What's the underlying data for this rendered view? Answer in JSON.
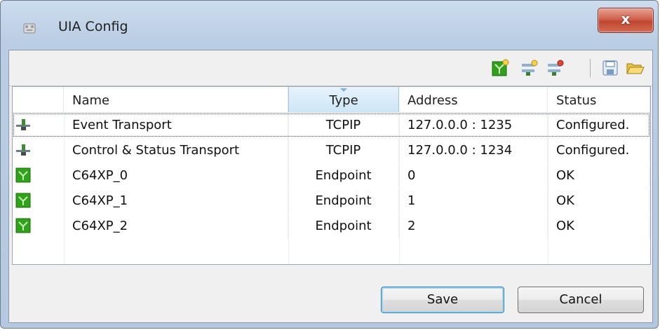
{
  "window": {
    "title": "UIA Config",
    "close_label": "x"
  },
  "toolbar": {
    "buttons": [
      {
        "icon": "add-endpoint-icon"
      },
      {
        "icon": "add-transport-icon"
      },
      {
        "icon": "remove-transport-icon"
      },
      {
        "icon": "save-icon"
      },
      {
        "icon": "open-folder-icon"
      }
    ]
  },
  "table": {
    "columns": [
      "Name",
      "Type",
      "Address",
      "Status"
    ],
    "rows": [
      {
        "icon": "transport-icon",
        "name": "Event Transport",
        "type": "TCPIP",
        "address": "127.0.0.0 : 1235",
        "status": "Configured."
      },
      {
        "icon": "transport-icon",
        "name": "Control & Status Transport",
        "type": "TCPIP",
        "address": "127.0.0.0 : 1234",
        "status": "Configured."
      },
      {
        "icon": "endpoint-icon",
        "name": "C64XP_0",
        "type": "Endpoint",
        "address": "0",
        "status": "OK"
      },
      {
        "icon": "endpoint-icon",
        "name": "C64XP_1",
        "type": "Endpoint",
        "address": "1",
        "status": "OK"
      },
      {
        "icon": "endpoint-icon",
        "name": "C64XP_2",
        "type": "Endpoint",
        "address": "2",
        "status": "OK"
      }
    ]
  },
  "buttons": {
    "save": "Save",
    "cancel": "Cancel"
  },
  "colors": {
    "endpoint_green": "#2fa11a",
    "title_bar": "#b9cde4",
    "close_red": "#c8503a"
  }
}
